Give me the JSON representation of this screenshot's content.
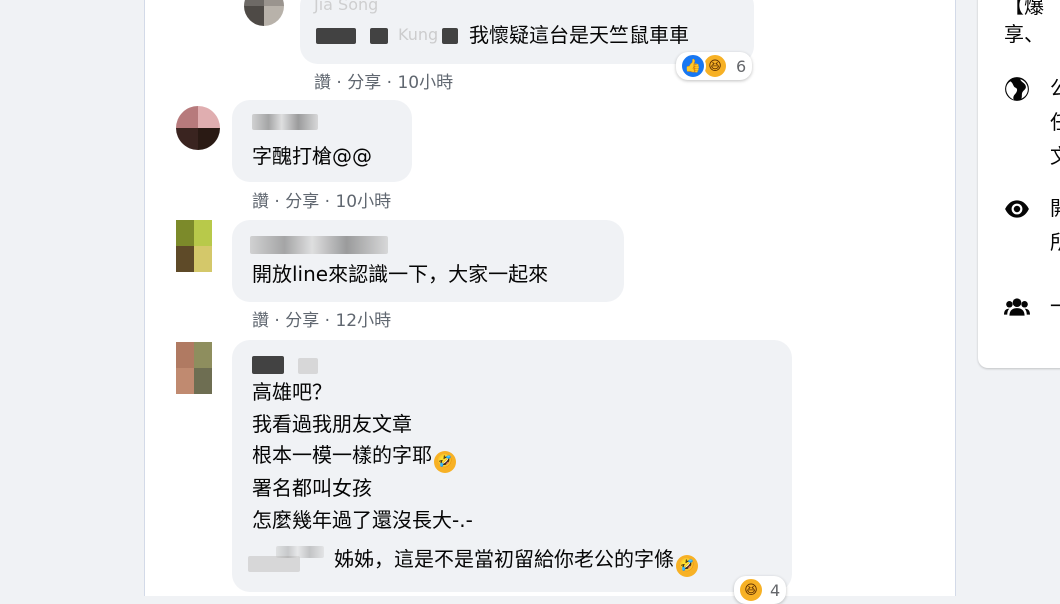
{
  "comments": [
    {
      "author": "Jia Song",
      "tag_partial": "Kung",
      "text_tail": "我懷疑這台是天竺鼠車車",
      "actions": [
        "讚",
        "分享"
      ],
      "time": "10小時",
      "reaction_count": "6",
      "reaction_icons": [
        "like-icon",
        "haha-icon"
      ]
    },
    {
      "text": "字醜打槍@@",
      "actions": [
        "讚",
        "分享"
      ],
      "time": "10小時"
    },
    {
      "text": "開放line來認識一下，大家一起來",
      "actions": [
        "讚",
        "分享"
      ],
      "time": "12小時"
    },
    {
      "lines": [
        "高雄吧？",
        "我看過我朋友文章",
        "根本一模一樣的字耶",
        "署名都叫女孩",
        "怎麼幾年過了還沒長大-.-"
      ],
      "reply_line": "姊姊，這是不是當初留給你老公的字條",
      "reaction_count": "4",
      "reaction_icons": [
        "haha-icon"
      ]
    }
  ],
  "separator": "·",
  "right_panel": {
    "heading_fragment": "【爆",
    "subtitle_fragment": "享、",
    "items": [
      {
        "icon": "globe-icon",
        "text_lines": [
          "公",
          "任",
          "文"
        ]
      },
      {
        "icon": "eye-icon",
        "text_lines": [
          "開",
          "所"
        ]
      },
      {
        "icon": "group-icon",
        "text_lines": [
          "一"
        ]
      }
    ]
  },
  "colors": {
    "page_bg": "#f0f2f5",
    "bubble_bg": "#f0f2f5",
    "meta_text": "#606770",
    "like_blue": "#1877f2",
    "haha_yellow": "#f7b125"
  }
}
